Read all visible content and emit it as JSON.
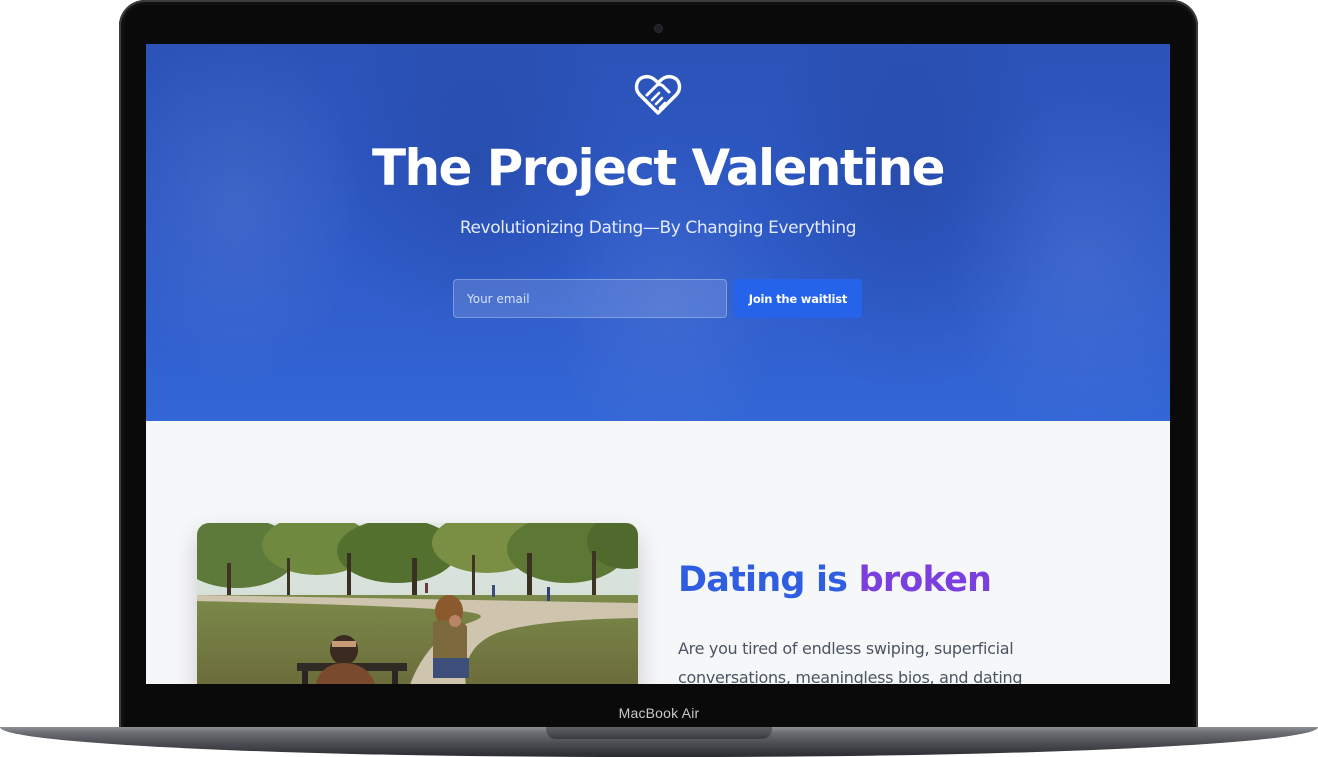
{
  "device": {
    "label": "MacBook Air"
  },
  "hero": {
    "logo_icon": "handshake-heart-icon",
    "title": "The Project Valentine",
    "subtitle": "Revolutionizing Dating—By Changing Everything",
    "email_placeholder": "Your email",
    "email_value": "",
    "join_button_label": "Join the waitlist",
    "background_color": "#2f5bc8",
    "button_color": "#2563eb"
  },
  "section": {
    "heading_part_1": "Dating is ",
    "heading_part_2": "broken",
    "body": "Are you tired of endless swiping, superficial conversations, meaningless bios, and dating",
    "heading_gradient": [
      "#2f5fe0",
      "#7b3fe0"
    ],
    "photo_alt_icon": "park-couple-photo"
  }
}
